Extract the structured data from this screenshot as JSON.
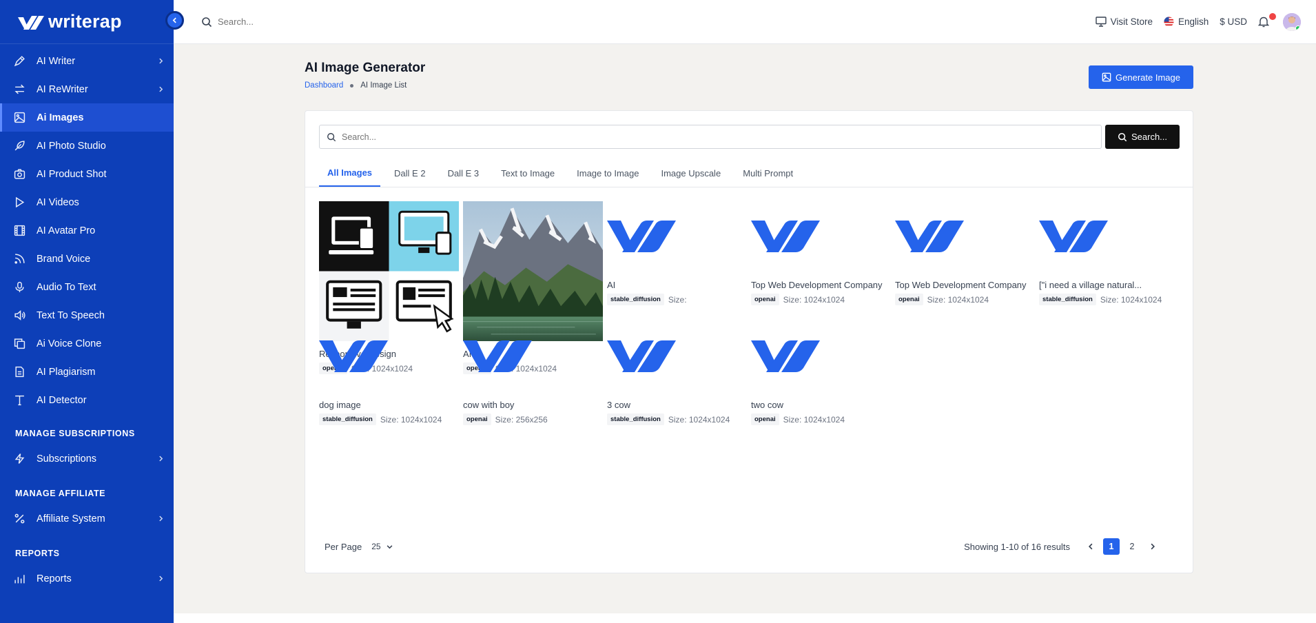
{
  "brand": {
    "name": "writerap",
    "accent": "#2563eb",
    "sidebar_bg": "#0d3fb8"
  },
  "sidebar": {
    "items": [
      {
        "label": "AI Writer",
        "icon": "pen-icon",
        "has_chevron": true
      },
      {
        "label": "AI ReWriter",
        "icon": "refresh-icon",
        "has_chevron": true
      },
      {
        "label": "Ai Images",
        "icon": "image-icon",
        "has_chevron": false,
        "active": true
      },
      {
        "label": "AI Photo Studio",
        "icon": "feather-icon",
        "has_chevron": false
      },
      {
        "label": "AI Product Shot",
        "icon": "camera-icon",
        "has_chevron": false
      },
      {
        "label": "AI Videos",
        "icon": "play-icon",
        "has_chevron": false
      },
      {
        "label": "AI Avatar Pro",
        "icon": "film-icon",
        "has_chevron": false
      },
      {
        "label": "Brand Voice",
        "icon": "rss-icon",
        "has_chevron": false
      },
      {
        "label": "Audio To Text",
        "icon": "microphone-icon",
        "has_chevron": false
      },
      {
        "label": "Text To Speech",
        "icon": "speaker-icon",
        "has_chevron": false
      },
      {
        "label": "Ai Voice Clone",
        "icon": "copy-icon",
        "has_chevron": false
      },
      {
        "label": "AI Plagiarism",
        "icon": "file-icon",
        "has_chevron": false
      },
      {
        "label": "AI Detector",
        "icon": "text-icon",
        "has_chevron": false
      }
    ],
    "sections": [
      {
        "title": "MANAGE SUBSCRIPTIONS",
        "item": {
          "label": "Subscriptions",
          "icon": "bolt-icon"
        }
      },
      {
        "title": "MANAGE AFFILIATE",
        "item": {
          "label": "Affiliate System",
          "icon": "percent-icon"
        }
      },
      {
        "title": "REPORTS",
        "item": {
          "label": "Reports",
          "icon": "bar-chart-icon"
        }
      }
    ]
  },
  "topbar": {
    "search_placeholder": "Search...",
    "visit_store": "Visit Store",
    "language": "English",
    "currency": "$ USD"
  },
  "page": {
    "title": "AI Image Generator",
    "breadcrumb": {
      "home": "Dashboard",
      "current": "AI Image List"
    },
    "generate_button": "Generate Image"
  },
  "filter": {
    "search_placeholder": "Search...",
    "search_button": "Search...",
    "tabs": [
      "All Images",
      "Dall E 2",
      "Dall E 3",
      "Text to Image",
      "Image to Image",
      "Image Upscale",
      "Multi Prompt"
    ],
    "active_tab": "All Images"
  },
  "images": [
    {
      "title": "Responsive Design",
      "provider": "openai",
      "size": "Size: 1024x1024",
      "thumb": "responsive-design"
    },
    {
      "title": "AI",
      "provider": "openai",
      "size": "Size: 1024x1024",
      "thumb": "mountain-lake"
    },
    {
      "title": "AI",
      "provider": "stable_diffusion",
      "size": "Size:",
      "thumb": "logo"
    },
    {
      "title": "Top Web Development Company",
      "provider": "openai",
      "size": "Size: 1024x1024",
      "thumb": "logo"
    },
    {
      "title": "Top Web Development Company",
      "provider": "openai",
      "size": "Size: 1024x1024",
      "thumb": "logo"
    },
    {
      "title": "[\"i need a village natural...",
      "provider": "stable_diffusion",
      "size": "Size: 1024x1024",
      "thumb": "logo"
    },
    {
      "title": "dog image",
      "provider": "stable_diffusion",
      "size": "Size: 1024x1024",
      "thumb": "logo"
    },
    {
      "title": "cow with boy",
      "provider": "openai",
      "size": "Size: 256x256",
      "thumb": "logo"
    },
    {
      "title": "3 cow",
      "provider": "stable_diffusion",
      "size": "Size: 1024x1024",
      "thumb": "logo"
    },
    {
      "title": "two cow",
      "provider": "openai",
      "size": "Size: 1024x1024",
      "thumb": "logo"
    }
  ],
  "pagination": {
    "per_page_label": "Per Page",
    "per_page_value": "25",
    "showing": "Showing 1-10 of 16 results",
    "pages": [
      "1",
      "2"
    ],
    "current_page": "1"
  }
}
